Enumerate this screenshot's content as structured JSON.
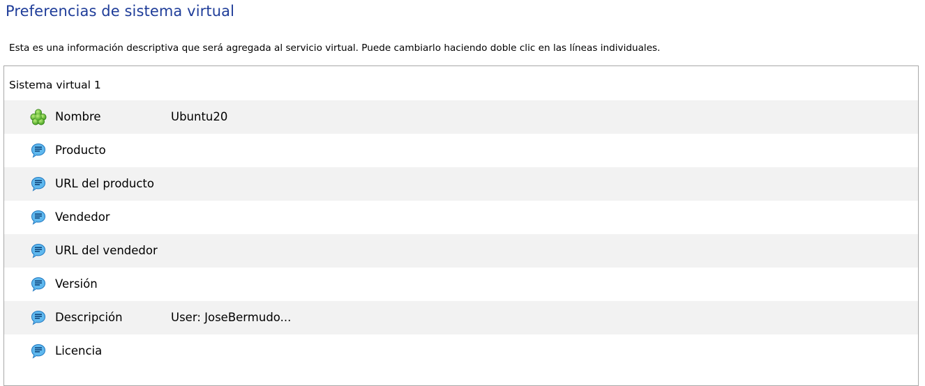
{
  "header": {
    "title": "Preferencias de sistema virtual",
    "description": "Esta es una información descriptiva que será agregada al servicio virtual. Puede cambiarlo haciendo doble clic en las líneas individuales."
  },
  "tree": {
    "group_label": "Sistema virtual 1",
    "rows": [
      {
        "icon": "green-puzzle-icon",
        "label": "Nombre",
        "value": "Ubuntu20"
      },
      {
        "icon": "speech-bubble-icon",
        "label": "Producto",
        "value": ""
      },
      {
        "icon": "speech-bubble-icon",
        "label": "URL del producto",
        "value": ""
      },
      {
        "icon": "speech-bubble-icon",
        "label": "Vendedor",
        "value": ""
      },
      {
        "icon": "speech-bubble-icon",
        "label": "URL del vendedor",
        "value": ""
      },
      {
        "icon": "speech-bubble-icon",
        "label": "Versión",
        "value": ""
      },
      {
        "icon": "speech-bubble-icon",
        "label": "Descripción",
        "value": "User: JoseBermudo..."
      },
      {
        "icon": "speech-bubble-icon",
        "label": "Licencia",
        "value": ""
      }
    ]
  },
  "colors": {
    "title": "#1f3d99",
    "row_alt": "#f2f2f2",
    "border": "#a8a8a8"
  }
}
